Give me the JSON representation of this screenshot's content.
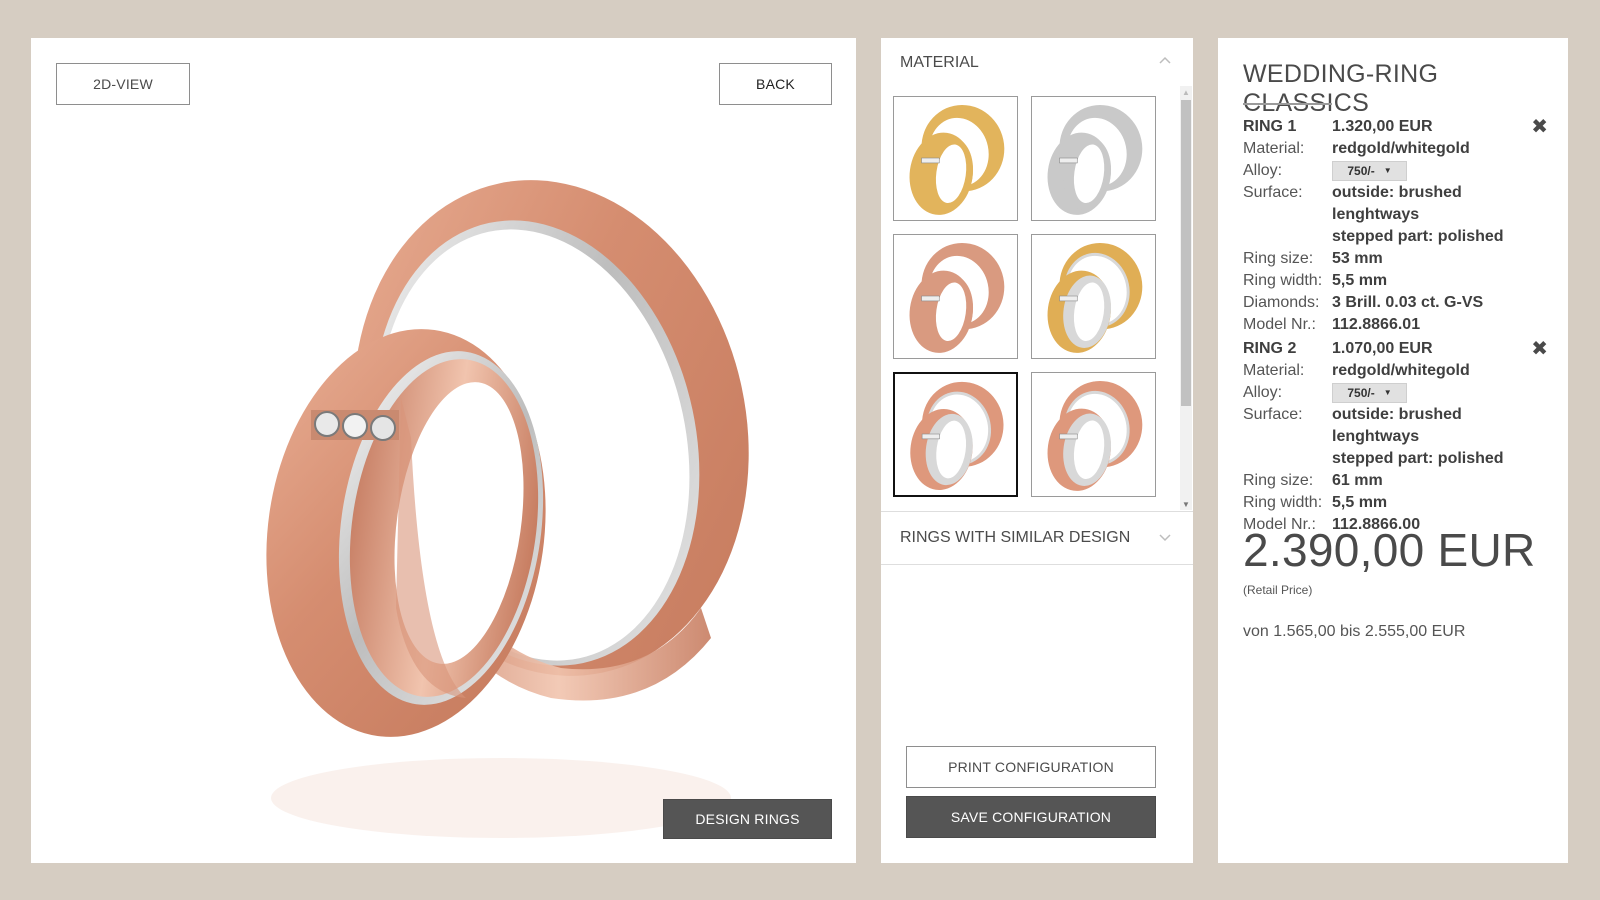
{
  "viewer": {
    "view_toggle_label": "2D-VIEW",
    "back_label": "BACK",
    "design_rings_label": "DESIGN RINGS",
    "image_alt": "rose gold / white gold wedding ring pair with three diamonds"
  },
  "material_panel": {
    "material_header": "MATERIAL",
    "similar_header": "RINGS WITH SIMILAR DESIGN",
    "thumbnails": [
      {
        "name": "yellowgold",
        "outer": "#e2b45c",
        "inner": "#e2b45c",
        "selected": false
      },
      {
        "name": "whitegold",
        "outer": "#c9c9c9",
        "inner": "#c9c9c9",
        "selected": false
      },
      {
        "name": "redgold",
        "outer": "#d99a80",
        "inner": "#d99a80",
        "selected": false
      },
      {
        "name": "yellowgold/whitegold",
        "outer": "#e0ae55",
        "inner": "#d8d8d8",
        "selected": false
      },
      {
        "name": "redgold/whitegold",
        "outer": "#de987c",
        "inner": "#d8d8d8",
        "selected": true
      },
      {
        "name": "redgold/whitegold-2",
        "outer": "#de987c",
        "inner": "#d8d8d8",
        "selected": false
      }
    ],
    "print_label": "PRINT CONFIGURATION",
    "save_label": "SAVE CONFIGURATION"
  },
  "summary": {
    "title": "WEDDING-RING CLASSICS",
    "labels": {
      "material": "Material:",
      "alloy": "Alloy:",
      "surface": "Surface:",
      "ring_size": "Ring size:",
      "ring_width": "Ring width:",
      "diamonds": "Diamonds:",
      "model": "Model Nr.:"
    },
    "ring1": {
      "name": "RING 1",
      "price": "1.320,00 EUR",
      "material": "redgold/whitegold",
      "alloy": "750/-",
      "surface_line1": "outside: brushed lenghtways",
      "surface_line2": "stepped part: polished",
      "ring_size": "53 mm",
      "ring_width": "5,5 mm",
      "diamonds": "3 Brill. 0.03 ct. G-VS",
      "model": "112.8866.01"
    },
    "ring2": {
      "name": "RING 2",
      "price": "1.070,00 EUR",
      "material": "redgold/whitegold",
      "alloy": "750/-",
      "surface_line1": "outside: brushed lenghtways",
      "surface_line2": "stepped part: polished",
      "ring_size": "61 mm",
      "ring_width": "5,5 mm",
      "model": "112.8866.00"
    },
    "total": "2.390,00 EUR",
    "retail_note": "(Retail Price)",
    "price_range": "von 1.565,00 bis 2.555,00 EUR"
  },
  "colors": {
    "background": "#d6cdc2",
    "dark_button": "#555555",
    "text": "#4a4a4a",
    "rose_gold": "#d8937a",
    "white_gold": "#d9d9d9"
  }
}
